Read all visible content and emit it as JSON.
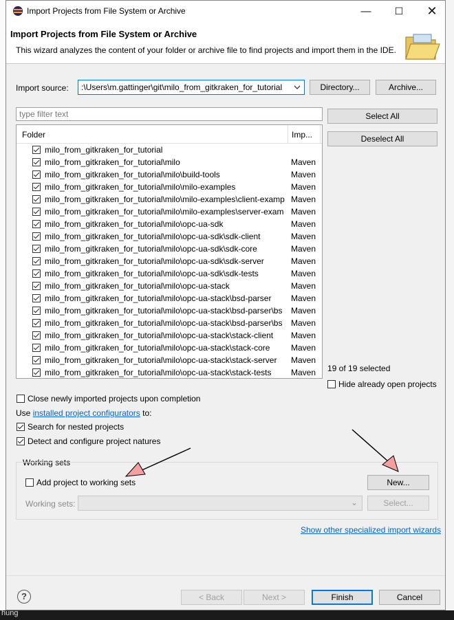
{
  "window": {
    "title": "Import Projects from File System or Archive"
  },
  "banner": {
    "title": "Import Projects from File System or Archive",
    "description": "This wizard analyzes the content of your folder or archive file to find projects and import them in the IDE."
  },
  "source": {
    "label": "Import source:",
    "value": ":\\Users\\m.gattinger\\git\\milo_from_gitkraken_for_tutorial",
    "directory_button": "Directory...",
    "archive_button": "Archive..."
  },
  "filter": {
    "placeholder": "type filter text"
  },
  "tree": {
    "columns": [
      "Folder",
      "Imp..."
    ],
    "rows": [
      {
        "folder": "milo_from_gitkraken_for_tutorial",
        "importer": "",
        "checked": true
      },
      {
        "folder": "milo_from_gitkraken_for_tutorial\\milo",
        "importer": "Maven",
        "checked": true
      },
      {
        "folder": "milo_from_gitkraken_for_tutorial\\milo\\build-tools",
        "importer": "Maven",
        "checked": true
      },
      {
        "folder": "milo_from_gitkraken_for_tutorial\\milo\\milo-examples",
        "importer": "Maven",
        "checked": true
      },
      {
        "folder": "milo_from_gitkraken_for_tutorial\\milo\\milo-examples\\client-examp",
        "importer": "Maven",
        "checked": true
      },
      {
        "folder": "milo_from_gitkraken_for_tutorial\\milo\\milo-examples\\server-exam",
        "importer": "Maven",
        "checked": true
      },
      {
        "folder": "milo_from_gitkraken_for_tutorial\\milo\\opc-ua-sdk",
        "importer": "Maven",
        "checked": true
      },
      {
        "folder": "milo_from_gitkraken_for_tutorial\\milo\\opc-ua-sdk\\sdk-client",
        "importer": "Maven",
        "checked": true
      },
      {
        "folder": "milo_from_gitkraken_for_tutorial\\milo\\opc-ua-sdk\\sdk-core",
        "importer": "Maven",
        "checked": true
      },
      {
        "folder": "milo_from_gitkraken_for_tutorial\\milo\\opc-ua-sdk\\sdk-server",
        "importer": "Maven",
        "checked": true
      },
      {
        "folder": "milo_from_gitkraken_for_tutorial\\milo\\opc-ua-sdk\\sdk-tests",
        "importer": "Maven",
        "checked": true
      },
      {
        "folder": "milo_from_gitkraken_for_tutorial\\milo\\opc-ua-stack",
        "importer": "Maven",
        "checked": true
      },
      {
        "folder": "milo_from_gitkraken_for_tutorial\\milo\\opc-ua-stack\\bsd-parser",
        "importer": "Maven",
        "checked": true
      },
      {
        "folder": "milo_from_gitkraken_for_tutorial\\milo\\opc-ua-stack\\bsd-parser\\bs",
        "importer": "Maven",
        "checked": true
      },
      {
        "folder": "milo_from_gitkraken_for_tutorial\\milo\\opc-ua-stack\\bsd-parser\\bs",
        "importer": "Maven",
        "checked": true
      },
      {
        "folder": "milo_from_gitkraken_for_tutorial\\milo\\opc-ua-stack\\stack-client",
        "importer": "Maven",
        "checked": true
      },
      {
        "folder": "milo_from_gitkraken_for_tutorial\\milo\\opc-ua-stack\\stack-core",
        "importer": "Maven",
        "checked": true
      },
      {
        "folder": "milo_from_gitkraken_for_tutorial\\milo\\opc-ua-stack\\stack-server",
        "importer": "Maven",
        "checked": true
      },
      {
        "folder": "milo_from_gitkraken_for_tutorial\\milo\\opc-ua-stack\\stack-tests",
        "importer": "Maven",
        "checked": true
      }
    ]
  },
  "side": {
    "select_all": "Select All",
    "deselect_all": "Deselect All",
    "selected_count": "19 of 19 selected",
    "hide_open_label": "Hide already open projects"
  },
  "options": {
    "close_newly": "Close newly imported projects upon completion",
    "use_prefix": "Use ",
    "configurators_link": "installed project configurators",
    "use_suffix": " to:",
    "search_nested": "Search for nested projects",
    "detect_natures": "Detect and configure project natures"
  },
  "working_sets": {
    "group_label": "Working sets",
    "add_label": "Add project to working sets",
    "new_button": "New...",
    "sets_label": "Working sets:",
    "select_button": "Select..."
  },
  "specialized_link": "Show other specialized import wizards",
  "footer": {
    "back": "< Back",
    "next": "Next >",
    "finish": "Finish",
    "cancel": "Cancel"
  },
  "background": {
    "bottom_text": "hung"
  },
  "icons": {
    "app": "eclipse-icon",
    "help": "help-icon",
    "banner": "folder-icon"
  },
  "colors": {
    "accent": "#0078d7",
    "link": "#0066cc",
    "annotation_arrow": "#f4a0a0"
  }
}
